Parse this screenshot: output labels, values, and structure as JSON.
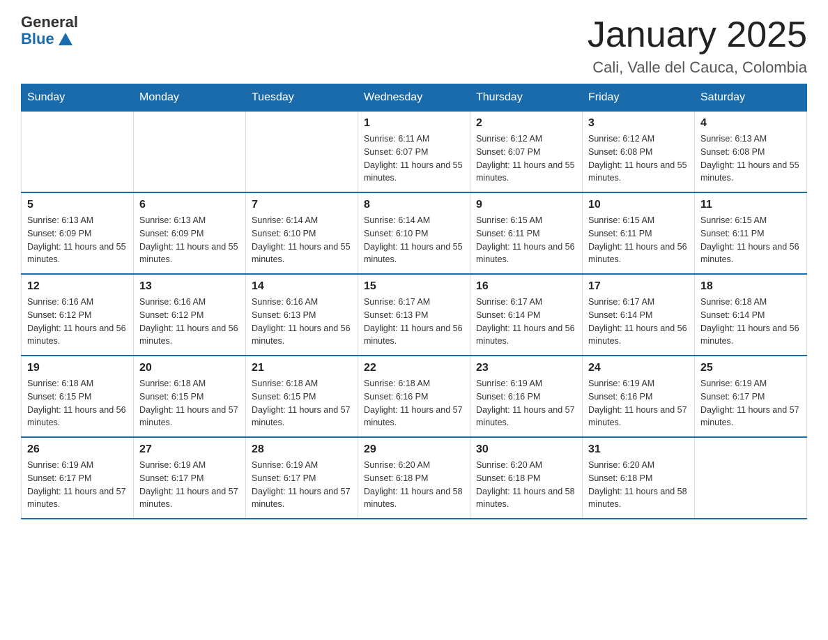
{
  "logo": {
    "general": "General",
    "blue": "Blue"
  },
  "title": "January 2025",
  "subtitle": "Cali, Valle del Cauca, Colombia",
  "days_of_week": [
    "Sunday",
    "Monday",
    "Tuesday",
    "Wednesday",
    "Thursday",
    "Friday",
    "Saturday"
  ],
  "weeks": [
    [
      {
        "day": "",
        "info": ""
      },
      {
        "day": "",
        "info": ""
      },
      {
        "day": "",
        "info": ""
      },
      {
        "day": "1",
        "info": "Sunrise: 6:11 AM\nSunset: 6:07 PM\nDaylight: 11 hours and 55 minutes."
      },
      {
        "day": "2",
        "info": "Sunrise: 6:12 AM\nSunset: 6:07 PM\nDaylight: 11 hours and 55 minutes."
      },
      {
        "day": "3",
        "info": "Sunrise: 6:12 AM\nSunset: 6:08 PM\nDaylight: 11 hours and 55 minutes."
      },
      {
        "day": "4",
        "info": "Sunrise: 6:13 AM\nSunset: 6:08 PM\nDaylight: 11 hours and 55 minutes."
      }
    ],
    [
      {
        "day": "5",
        "info": "Sunrise: 6:13 AM\nSunset: 6:09 PM\nDaylight: 11 hours and 55 minutes."
      },
      {
        "day": "6",
        "info": "Sunrise: 6:13 AM\nSunset: 6:09 PM\nDaylight: 11 hours and 55 minutes."
      },
      {
        "day": "7",
        "info": "Sunrise: 6:14 AM\nSunset: 6:10 PM\nDaylight: 11 hours and 55 minutes."
      },
      {
        "day": "8",
        "info": "Sunrise: 6:14 AM\nSunset: 6:10 PM\nDaylight: 11 hours and 55 minutes."
      },
      {
        "day": "9",
        "info": "Sunrise: 6:15 AM\nSunset: 6:11 PM\nDaylight: 11 hours and 56 minutes."
      },
      {
        "day": "10",
        "info": "Sunrise: 6:15 AM\nSunset: 6:11 PM\nDaylight: 11 hours and 56 minutes."
      },
      {
        "day": "11",
        "info": "Sunrise: 6:15 AM\nSunset: 6:11 PM\nDaylight: 11 hours and 56 minutes."
      }
    ],
    [
      {
        "day": "12",
        "info": "Sunrise: 6:16 AM\nSunset: 6:12 PM\nDaylight: 11 hours and 56 minutes."
      },
      {
        "day": "13",
        "info": "Sunrise: 6:16 AM\nSunset: 6:12 PM\nDaylight: 11 hours and 56 minutes."
      },
      {
        "day": "14",
        "info": "Sunrise: 6:16 AM\nSunset: 6:13 PM\nDaylight: 11 hours and 56 minutes."
      },
      {
        "day": "15",
        "info": "Sunrise: 6:17 AM\nSunset: 6:13 PM\nDaylight: 11 hours and 56 minutes."
      },
      {
        "day": "16",
        "info": "Sunrise: 6:17 AM\nSunset: 6:14 PM\nDaylight: 11 hours and 56 minutes."
      },
      {
        "day": "17",
        "info": "Sunrise: 6:17 AM\nSunset: 6:14 PM\nDaylight: 11 hours and 56 minutes."
      },
      {
        "day": "18",
        "info": "Sunrise: 6:18 AM\nSunset: 6:14 PM\nDaylight: 11 hours and 56 minutes."
      }
    ],
    [
      {
        "day": "19",
        "info": "Sunrise: 6:18 AM\nSunset: 6:15 PM\nDaylight: 11 hours and 56 minutes."
      },
      {
        "day": "20",
        "info": "Sunrise: 6:18 AM\nSunset: 6:15 PM\nDaylight: 11 hours and 57 minutes."
      },
      {
        "day": "21",
        "info": "Sunrise: 6:18 AM\nSunset: 6:15 PM\nDaylight: 11 hours and 57 minutes."
      },
      {
        "day": "22",
        "info": "Sunrise: 6:18 AM\nSunset: 6:16 PM\nDaylight: 11 hours and 57 minutes."
      },
      {
        "day": "23",
        "info": "Sunrise: 6:19 AM\nSunset: 6:16 PM\nDaylight: 11 hours and 57 minutes."
      },
      {
        "day": "24",
        "info": "Sunrise: 6:19 AM\nSunset: 6:16 PM\nDaylight: 11 hours and 57 minutes."
      },
      {
        "day": "25",
        "info": "Sunrise: 6:19 AM\nSunset: 6:17 PM\nDaylight: 11 hours and 57 minutes."
      }
    ],
    [
      {
        "day": "26",
        "info": "Sunrise: 6:19 AM\nSunset: 6:17 PM\nDaylight: 11 hours and 57 minutes."
      },
      {
        "day": "27",
        "info": "Sunrise: 6:19 AM\nSunset: 6:17 PM\nDaylight: 11 hours and 57 minutes."
      },
      {
        "day": "28",
        "info": "Sunrise: 6:19 AM\nSunset: 6:17 PM\nDaylight: 11 hours and 57 minutes."
      },
      {
        "day": "29",
        "info": "Sunrise: 6:20 AM\nSunset: 6:18 PM\nDaylight: 11 hours and 58 minutes."
      },
      {
        "day": "30",
        "info": "Sunrise: 6:20 AM\nSunset: 6:18 PM\nDaylight: 11 hours and 58 minutes."
      },
      {
        "day": "31",
        "info": "Sunrise: 6:20 AM\nSunset: 6:18 PM\nDaylight: 11 hours and 58 minutes."
      },
      {
        "day": "",
        "info": ""
      }
    ]
  ]
}
